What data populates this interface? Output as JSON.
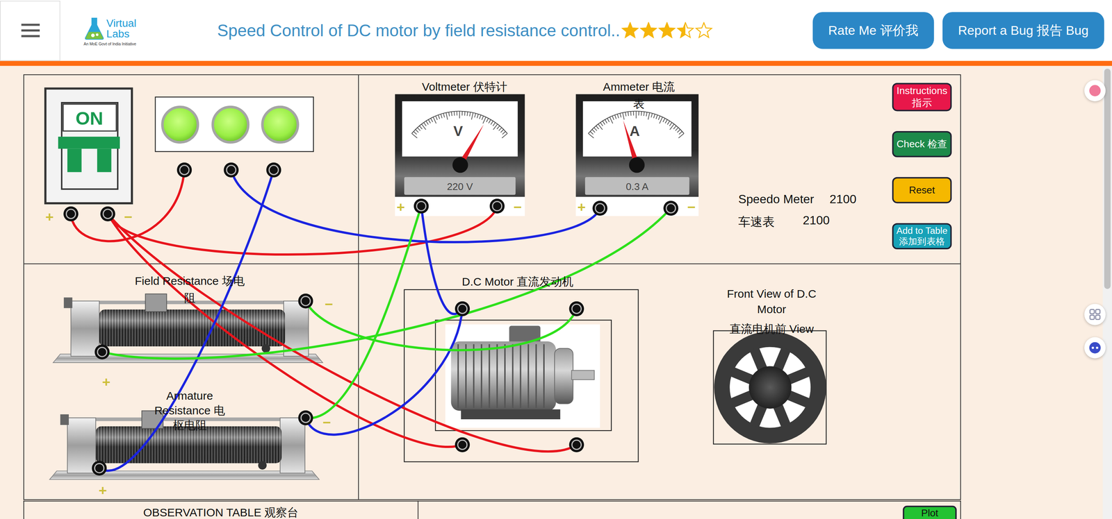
{
  "header": {
    "logo": {
      "top": "Virtual",
      "bottom": "Labs",
      "tagline": "An MoE Govt of India Initiative"
    },
    "title": "Speed Control of DC motor by field resistance control..",
    "rating": {
      "stars": 3.5
    },
    "buttons": [
      "Rate Me  评价我",
      "Report a Bug  报告 Bug"
    ]
  },
  "breaker": {
    "label": "ON",
    "on": true,
    "plus": "+",
    "minus": "−"
  },
  "lamps": [
    {
      "on": true
    },
    {
      "on": true
    },
    {
      "on": true
    }
  ],
  "meters": [
    {
      "title": "Voltmeter  伏特计",
      "symbol": "V",
      "reading": "220 V",
      "level": 0.8,
      "plus": "+",
      "minus": "−"
    },
    {
      "title": "Ammeter  电流表",
      "symbol": "A",
      "reading": "0.3 A",
      "level": 0.33,
      "plus": "+",
      "minus": "−"
    }
  ],
  "speedometer": {
    "label": "Speedo Meter",
    "value": "2100",
    "label_zh": "车速表",
    "value_zh": "2100"
  },
  "controls": [
    {
      "label": "Instructions 指示",
      "color": "#e8174a"
    },
    {
      "label": "Check 检查",
      "color": "#1d8a4a"
    },
    {
      "label": "Reset",
      "color": "#f5b800"
    },
    {
      "label": "Add to Table 添加到表格",
      "color": "#17a2b8"
    }
  ],
  "rheostats": [
    {
      "title": "Field Resistance  场电阻",
      "minus": "−",
      "plus": "+"
    },
    {
      "title": "Armature Resistance 电枢电阻",
      "minus": "−",
      "plus": "+"
    }
  ],
  "motor": {
    "title": "D.C Motor  直流发动机"
  },
  "front_view": {
    "title": "Front View of D.C Motor",
    "subtitle": "直流电机前 View"
  },
  "wires": [
    {
      "color": "#e8141c"
    },
    {
      "color": "#e8141c"
    },
    {
      "color": "#e8141c"
    },
    {
      "color": "#e8141c"
    },
    {
      "color": "#1a23e0"
    },
    {
      "color": "#1a23e0"
    },
    {
      "color": "#1a23e0"
    },
    {
      "color": "#1a23e0"
    },
    {
      "color": "#2de01a"
    },
    {
      "color": "#2de01a"
    },
    {
      "color": "#2de01a"
    }
  ],
  "observation": {
    "title": "OBSERVATION TABLE  观察台"
  },
  "plot_button": "Plot"
}
